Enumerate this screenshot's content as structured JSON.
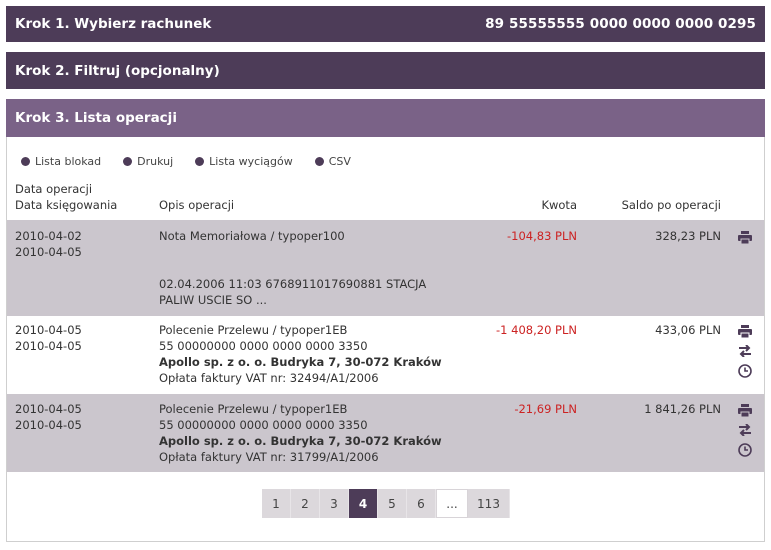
{
  "steps": {
    "step1_title": "Krok 1. Wybierz rachunek",
    "step1_account": "89 55555555 0000 0000 0000 0295",
    "step2_title": "Krok 2. Filtruj (opcjonalny)",
    "step3_title": "Krok 3. Lista operacji"
  },
  "actions": [
    "Lista blokad",
    "Drukuj",
    "Lista wyciągów",
    "CSV"
  ],
  "columns": {
    "date_op": "Data operacji",
    "date_book": "Data księgowania",
    "desc": "Opis operacji",
    "amount": "Kwota",
    "balance": "Saldo po operacji"
  },
  "rows": [
    {
      "date_op": "2010-04-02",
      "date_book": "2010-04-05",
      "desc_title": "Nota Memoriałowa / typoper100",
      "desc_detail_1": "02.04.2006 11:03 6768911017690881 STACJA",
      "desc_detail_2": "PALIW USCIE SO ...",
      "amount": "-104,83 PLN",
      "balance": "328,23 PLN"
    },
    {
      "date_op": "2010-04-05",
      "date_book": "2010-04-05",
      "desc_title": "Polecenie Przelewu / typoper1EB",
      "desc_account": "55 00000000 0000 0000 0000 3350",
      "desc_party": "Apollo sp. z o. o. Budryka 7, 30-072 Kraków",
      "desc_note": "Opłata faktury VAT nr: 32494/A1/2006",
      "amount": "-1 408,20 PLN",
      "balance": "433,06 PLN"
    },
    {
      "date_op": "2010-04-05",
      "date_book": "2010-04-05",
      "desc_title": "Polecenie Przelewu / typoper1EB",
      "desc_account": "55 00000000 0000 0000 0000 3350",
      "desc_party": "Apollo sp. z o. o. Budryka 7, 30-072 Kraków",
      "desc_note": "Opłata faktury VAT nr: 31799/A1/2006",
      "amount": "-21,69 PLN",
      "balance": "1 841,26 PLN"
    }
  ],
  "pagination": {
    "pages": [
      "1",
      "2",
      "3",
      "4",
      "5",
      "6",
      "...",
      "113"
    ],
    "current": "4"
  },
  "colors": {
    "header_dark": "#4d3c58",
    "header_light": "#7a6287",
    "row_shade": "#cbc6cd",
    "negative": "#cc2222"
  },
  "icons": {
    "print": "printer-icon",
    "transfer": "transfer-arrows-icon",
    "history": "clock-icon"
  }
}
